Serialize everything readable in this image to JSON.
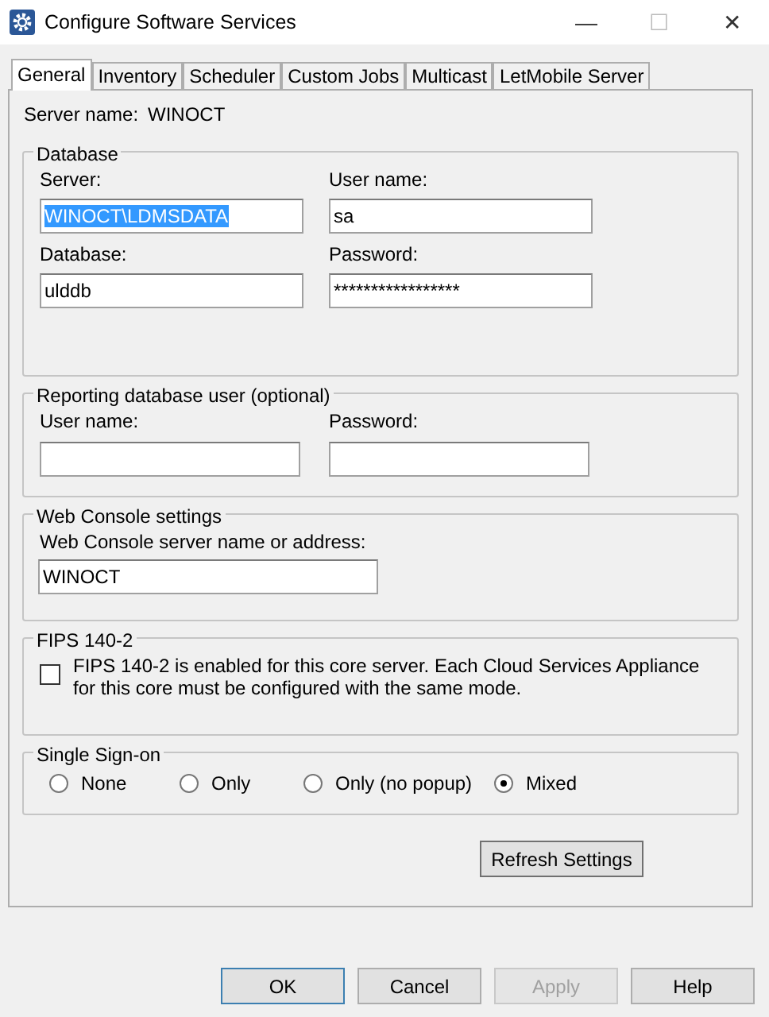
{
  "window": {
    "title": "Configure Software Services",
    "controls": [
      "—",
      "☐",
      "✕"
    ]
  },
  "tabs": [
    {
      "label": "General",
      "selected": true
    },
    {
      "label": "Inventory",
      "selected": false
    },
    {
      "label": "Scheduler",
      "selected": false
    },
    {
      "label": "Custom Jobs",
      "selected": false
    },
    {
      "label": "Multicast",
      "selected": false
    },
    {
      "label": "LetMobile Server",
      "selected": false
    }
  ],
  "server_name": {
    "label": "Server name:",
    "value": "WINOCT"
  },
  "database": {
    "title": "Database",
    "fields": [
      {
        "label": "Server:",
        "value": "WINOCT\\LDMSDATA",
        "text_selected": true
      },
      {
        "label": "User name:",
        "value": "sa",
        "text_selected": false
      },
      {
        "label": "Database:",
        "value": "ulddb",
        "text_selected": false
      },
      {
        "label": "Password:",
        "value": "*****************",
        "text_selected": false
      }
    ]
  },
  "reporting": {
    "title": "Reporting database user (optional)",
    "fields": [
      {
        "label": "User name:"
      },
      {
        "label": "Password:"
      }
    ]
  },
  "web_console": {
    "title": "Web Console settings",
    "label": "Web Console server name or address:",
    "value": "WINOCT"
  },
  "fips": {
    "title": "FIPS 140-2",
    "label": "FIPS 140-2 is enabled for this core server.  Each Cloud Services Appliance for this core must be configured with the same mode.",
    "checked": false
  },
  "sso": {
    "title": "Single Sign-on",
    "options": [
      {
        "label": "None",
        "selected": false
      },
      {
        "label": "Only",
        "selected": false
      },
      {
        "label": "Only (no popup)",
        "selected": false
      },
      {
        "label": "Mixed",
        "selected": true
      }
    ]
  },
  "refresh_button": "Refresh Settings",
  "buttons": [
    {
      "label": "OK",
      "disabled": false
    },
    {
      "label": "Cancel",
      "disabled": false
    },
    {
      "label": "Apply",
      "disabled": true
    },
    {
      "label": "Help",
      "disabled": false
    }
  ]
}
